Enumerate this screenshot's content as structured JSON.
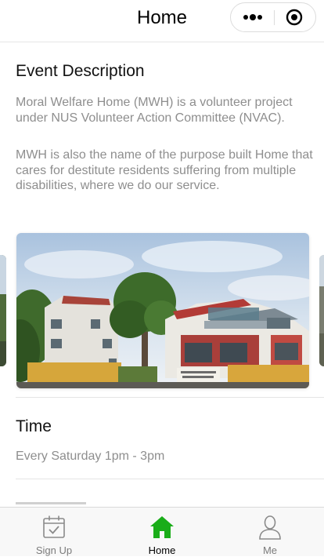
{
  "header": {
    "title": "Home",
    "more_icon": "more-dots-icon",
    "close_icon": "target-close-icon"
  },
  "event": {
    "heading": "Event Description",
    "paragraph_1": "Moral Welfare Home (MWH) is a volunteer project under NUS Volunteer Action Committee (NVAC).",
    "paragraph_2": "MWH is also the name of the purpose built Home that cares for destitute residents suffering from multiple disabilities, where we do our service."
  },
  "carousel": {
    "image_icon": "building-photo"
  },
  "time": {
    "heading": "Time",
    "value": "Every Saturday 1pm - 3pm"
  },
  "tabbar": {
    "tabs": [
      {
        "label": "Sign Up",
        "icon": "calendar-check-icon",
        "active": false
      },
      {
        "label": "Home",
        "icon": "home-icon",
        "active": true
      },
      {
        "label": "Me",
        "icon": "person-icon",
        "active": false
      }
    ]
  },
  "colors": {
    "active_tab": "#1aad19",
    "inactive_tab": "#7b7b7b",
    "body_text_grey": "#8e8e8e"
  }
}
